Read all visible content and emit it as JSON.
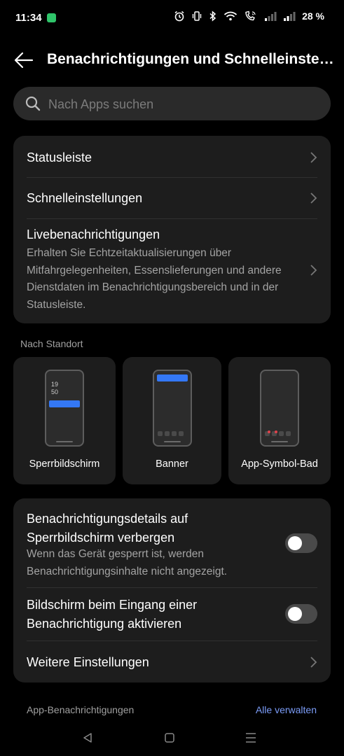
{
  "status_bar": {
    "time": "11:34",
    "battery": "28 %",
    "icons": [
      "app-badge-icon",
      "alarm-icon",
      "vibrate-icon",
      "bluetooth-icon",
      "wifi-icon",
      "call-icon",
      "signal-icon",
      "signal-icon-2"
    ]
  },
  "header": {
    "title": "Benachrichtigungen und Schnelleinstellungen"
  },
  "search": {
    "placeholder": "Nach Apps suchen"
  },
  "main_settings": [
    {
      "label": "Statusleiste"
    },
    {
      "label": "Schnelleinstellungen"
    },
    {
      "label": "Livebenachrichtigungen",
      "description": "Erhalten Sie Echtzeitaktualisierungen über Mitfahrgelegenheiten, Essenslieferungen und andere Dienstdaten im Benachrichtigungsbereich und in der Statusleiste."
    }
  ],
  "location_section": {
    "label": "Nach Standort",
    "styles": [
      {
        "label": "Sperrbildschirm",
        "clock": [
          "19",
          "50"
        ]
      },
      {
        "label": "Banner"
      },
      {
        "label": "App-Symbol-Bad"
      }
    ]
  },
  "privacy_settings": {
    "hide_details": {
      "label": "Benachrichtigungsdetails auf Sperrbildschirm verbergen",
      "description": "Wenn das Gerät gesperrt ist, werden Benachrichtigungsinhalte nicht angezeigt.",
      "enabled": false
    },
    "wake_screen": {
      "label": "Bildschirm beim Eingang einer Benachrichtigung aktivieren",
      "enabled": false
    },
    "more": {
      "label": "Weitere Einstellungen"
    }
  },
  "app_notifications": {
    "label": "App-Benachrichtigungen",
    "manage_label": "Alle verwalten"
  },
  "colors": {
    "accent": "#3478f6",
    "link": "#7b9cf7",
    "card": "#1d1d1d",
    "badge_dot": "#e0424c"
  }
}
